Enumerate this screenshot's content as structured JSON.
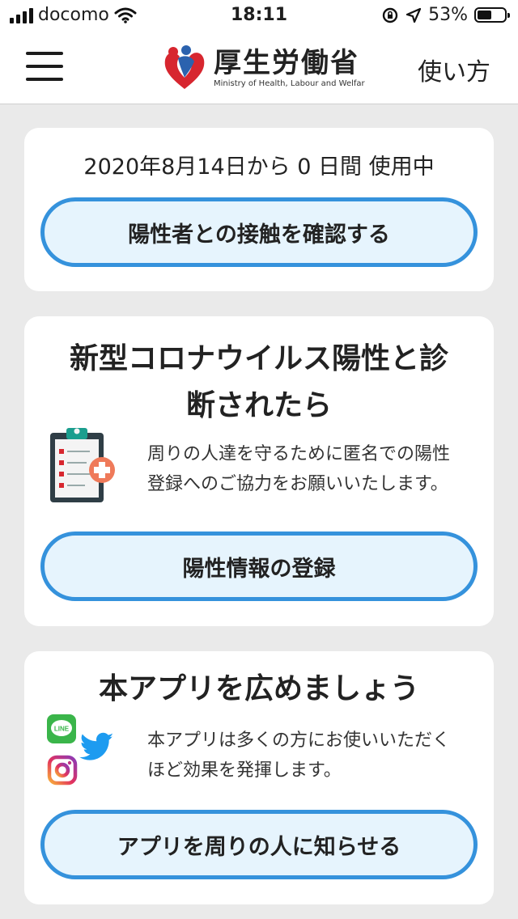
{
  "status_bar": {
    "carrier": "docomo",
    "time": "18:11",
    "battery": "53%",
    "battery_level": 0.53
  },
  "header": {
    "menu_icon": "hamburger-menu-icon",
    "logo_title": "厚生労働省",
    "logo_subtitle": "Ministry of Health, Labour and Welfar",
    "howto_label": "使い方"
  },
  "card_usage": {
    "usage_text": "2020年8月14日から 0 日間 使用中",
    "button_label": "陽性者との接触を確認する"
  },
  "card_positive": {
    "title_line1": "新型コロナウイルス陽性と診",
    "title_line2": "断されたら",
    "icon": "clipboard-medical-icon",
    "description_line1": "周りの人達を守るために匿名での陽性",
    "description_line2": "登録へのご協力をお願いいたします。",
    "button_label": "陽性情報の登録"
  },
  "card_share": {
    "title": "本アプリを広めましょう",
    "description_line1": "本アプリは多くの方にお使いいただく",
    "description_line2": "ほど効果を発揮します。",
    "line_icon_text": "LINE",
    "button_label": "アプリを周りの人に知らせる"
  },
  "colors": {
    "button_border": "#3592dc",
    "button_fill": "#e6f4fd",
    "background": "#eaeaea",
    "logo_red": "#d7262f",
    "logo_blue": "#2b62ae",
    "line_green": "#3ab54a",
    "twitter_blue": "#1d9bf0"
  }
}
